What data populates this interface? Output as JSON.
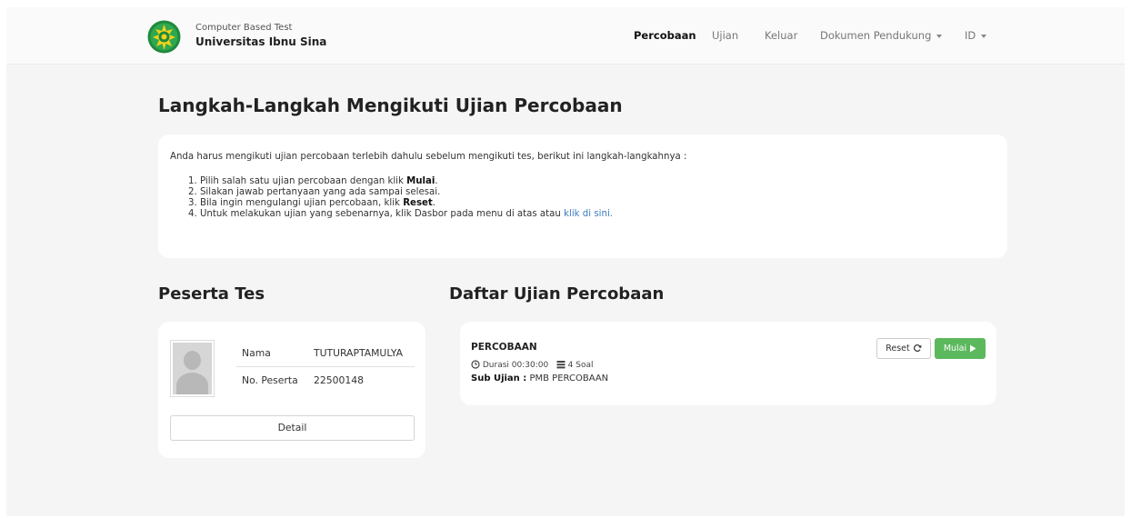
{
  "header": {
    "brand_subtitle": "Computer Based Test",
    "brand_title": "Universitas Ibnu Sina",
    "nav": {
      "trial": "Percobaan",
      "exam": "Ujian",
      "logout": "Keluar",
      "documents": "Dokumen Pendukung",
      "language": "ID"
    }
  },
  "steps_section": {
    "heading": "Langkah-Langkah Mengikuti Ujian Percobaan",
    "intro": "Anda harus mengikuti ujian percobaan terlebih dahulu sebelum mengikuti tes, berikut ini langkah-langkahnya :",
    "step1_text": "1. Pilih salah satu ujian percobaan dengan klik ",
    "step1_bold": "Mulai",
    "step2_text": "2. Silakan jawab pertanyaan yang ada sampai selesai.",
    "step3_text": "3. Bila ingin mengulangi ujian percobaan, klik ",
    "step3_bold": "Reset",
    "step4_text": "4. Untuk melakukan ujian yang sebenarnya, klik Dasbor pada menu di atas atau ",
    "step4_link": "klik di sini"
  },
  "participant": {
    "heading": "Peserta Tes",
    "name_label": "Nama",
    "name_value": "TUTURAPTAMULYA",
    "number_label": "No. Peserta",
    "number_value": "22500148",
    "detail_button": "Detail"
  },
  "exams": {
    "heading": "Daftar Ujian Percobaan",
    "items": [
      {
        "title": "PERCOBAAN",
        "duration": "Durasi 00:30:00",
        "questions": "4 Soal",
        "sub_label": "Sub Ujian :",
        "sub_value": "PMB PERCOBAAN",
        "reset_label": "Reset",
        "start_label": "Mulai"
      }
    ]
  },
  "colors": {
    "accent_green": "#5cb85c",
    "link_blue": "#3a7bbf",
    "page_background": "#f5f5f5"
  }
}
